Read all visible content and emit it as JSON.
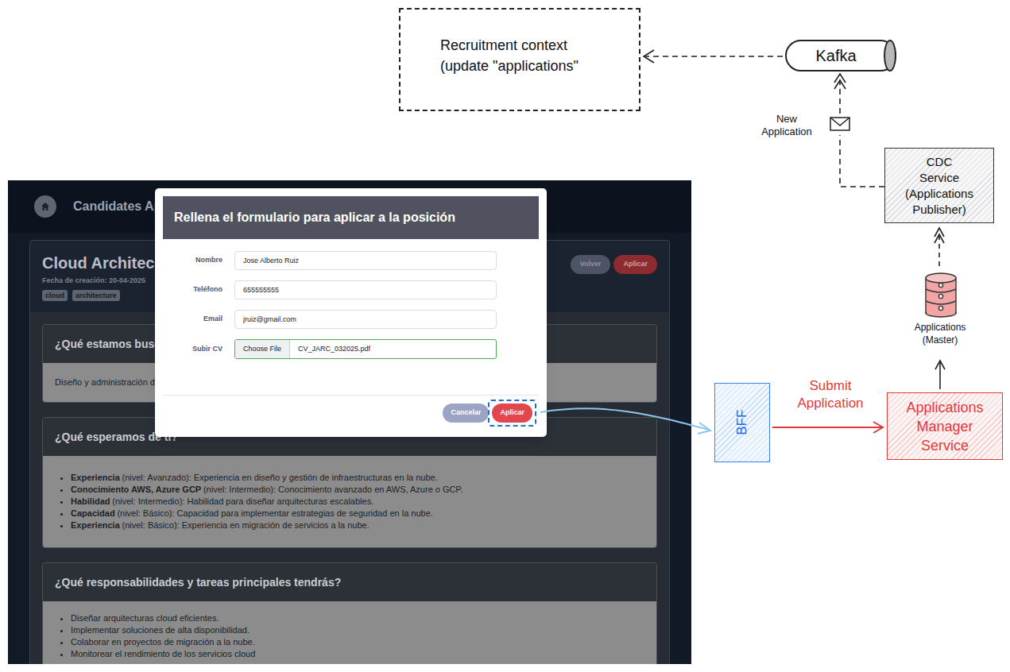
{
  "diagram": {
    "recruitment_context": {
      "lines": [
        "Recruitment context",
        "(update \"applications\""
      ]
    },
    "kafka": {
      "label": "Kafka"
    },
    "new_application_edge": {
      "lines": [
        "New",
        "Application"
      ]
    },
    "cdc_service": {
      "lines": [
        "CDC",
        "Service",
        "(Applications",
        "Publisher)"
      ]
    },
    "database": {
      "lines": [
        "Applications",
        "(Master)"
      ]
    },
    "bff": {
      "label": "BFF"
    },
    "submit_edge": {
      "lines": [
        "Submit",
        "Application"
      ]
    },
    "manager_service": {
      "lines": [
        "Applications",
        "Manager",
        "Service"
      ]
    }
  },
  "app": {
    "header": {
      "title": "Candidates Ap"
    },
    "position": {
      "title": "Cloud Architec",
      "created": "Fecha de creación: 20-04-2025",
      "tags": [
        "cloud",
        "architecture"
      ],
      "buttons": [
        "Volver",
        "Aplicar"
      ]
    },
    "sections": [
      {
        "kind": "paragraph",
        "title": "¿Qué estamos busca",
        "text": "Diseño y administración de"
      },
      {
        "kind": "detail-list",
        "title": "¿Qué esperamos de ti?",
        "items": [
          {
            "label": "Experiencia",
            "detail": "(nivel: Avanzado): Experiencia en diseño y gestión de infraestructuras en la nube."
          },
          {
            "label": "Conocimiento AWS, Azure GCP",
            "detail": "(nivel: Intermedio): Conocimiento avanzado en AWS, Azure o GCP."
          },
          {
            "label": "Habilidad",
            "detail": "(nivel: Intermedio): Habilidad para diseñar arquitecturas escalables."
          },
          {
            "label": "Capacidad",
            "detail": "(nivel: Básico): Capacidad para implementar estrategias de seguridad en la nube."
          },
          {
            "label": "Experiencia",
            "detail": "(nivel: Básico): Experiencia en migración de servicios a la nube."
          }
        ]
      },
      {
        "kind": "bullet-list",
        "title": "¿Qué responsabilidades y tareas principales tendrás?",
        "items": [
          {
            "text": "Diseñar arquitecturas cloud eficientes."
          },
          {
            "text": "Implementar soluciones de alta disponibilidad."
          },
          {
            "text": "Colaborar en proyectos de migración a la nube."
          },
          {
            "text": "Monitorear el rendimiento de los servicios cloud"
          }
        ]
      }
    ]
  },
  "modal": {
    "title": "Rellena el formulario para aplicar a la posición",
    "fields": [
      {
        "kind": "text",
        "label": "Nombre",
        "value": "Jose Alberto Ruiz"
      },
      {
        "kind": "text",
        "label": "Teléfono",
        "value": "655555555"
      },
      {
        "kind": "text",
        "label": "Email",
        "value": "jruiz@gmail.com"
      },
      {
        "kind": "file",
        "label": "Subir CV",
        "button": "Choose File",
        "value": "CV_JARC_032025.pdf"
      }
    ],
    "buttons": [
      {
        "label": "Cancelar",
        "highlighted": false
      },
      {
        "label": "Aplicar",
        "highlighted": true
      }
    ]
  }
}
